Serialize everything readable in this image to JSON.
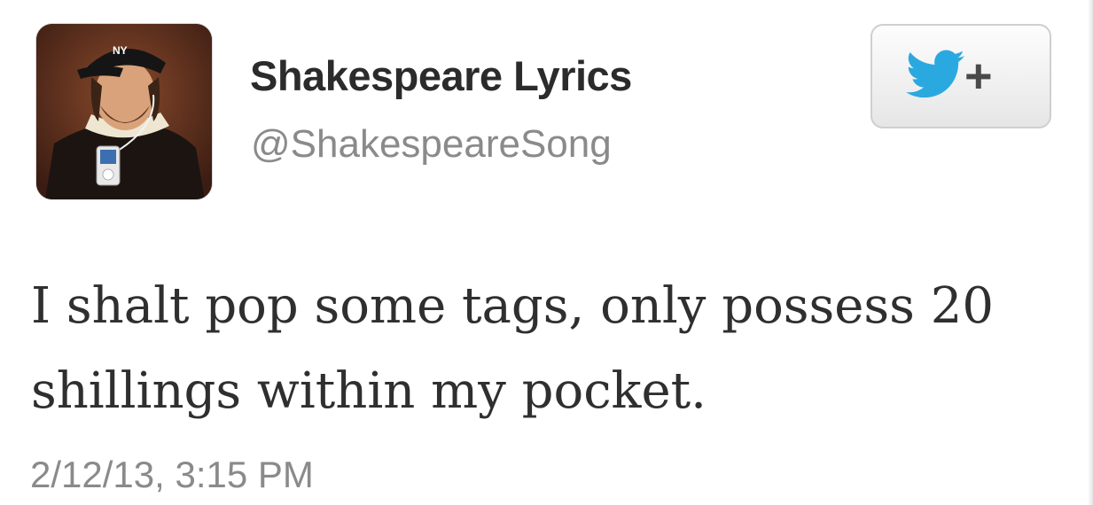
{
  "tweet": {
    "display_name": "Shakespeare Lyrics",
    "handle": "@ShakespeareSong",
    "text": "I shalt pop some tags, only possess 20 shillings within my pocket.",
    "timestamp": "2/12/13, 3:15 PM"
  },
  "follow_button": {
    "icon": "twitter-bird-icon",
    "plus_label": "+"
  },
  "colors": {
    "bird_blue": "#2aa9e0",
    "name_text": "#2b2b2b",
    "muted_text": "#8a8a8a",
    "body_text": "#2f2f2f"
  },
  "avatar": {
    "icon": "avatar-portrait"
  }
}
